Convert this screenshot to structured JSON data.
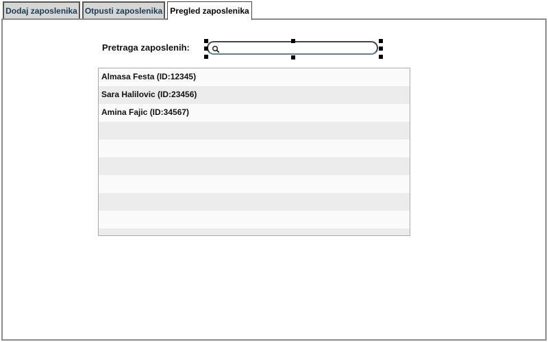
{
  "tabs": [
    {
      "label": "Dodaj zaposlenika",
      "active": false
    },
    {
      "label": "Otpusti zaposlenika",
      "active": false
    },
    {
      "label": "Pregled zaposlenika",
      "active": true
    }
  ],
  "search": {
    "label": "Pretraga zaposlenih:",
    "value": "",
    "icon": "search-icon"
  },
  "employees": [
    "Almasa Festa (ID:12345)",
    "Sara Halilovic (ID:23456)",
    "Amina Fajic (ID:34567)"
  ],
  "colors": {
    "tab_inactive_bg": "#d4d7d6",
    "tab_text": "#1d3b4f",
    "row_alt": "#ececec"
  }
}
